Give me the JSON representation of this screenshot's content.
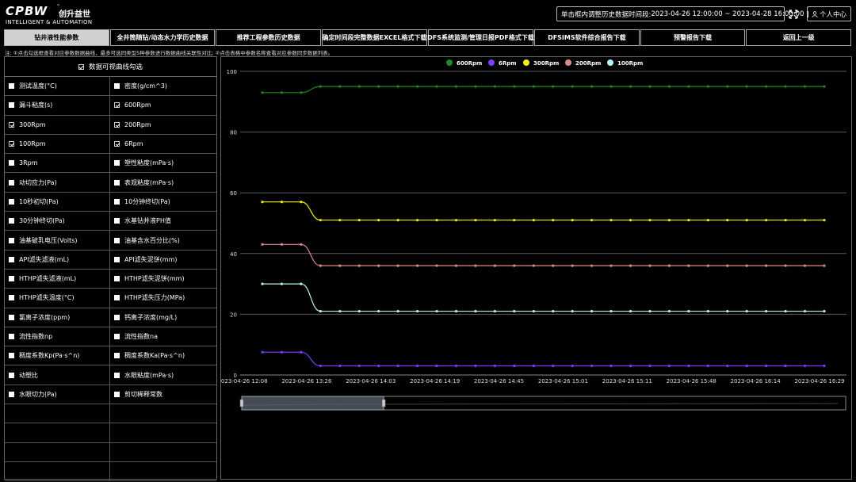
{
  "header": {
    "logo": "CPBW",
    "logo_tm": "™",
    "logo_cn": "创升益世",
    "logo_sub": "INTELLIGENT & AUTOMATION",
    "time_label": "单击框内调整历史数据时间段:",
    "time_range": "2023-04-26 12:00:00 ~ 2023-04-28 16:00:00",
    "user_label": "个人中心"
  },
  "nav": [
    {
      "label": "钻井液性能参数",
      "active": true
    },
    {
      "label": "全井筒随钻/动态水力学历史数据",
      "active": false
    },
    {
      "label": "推荐工程参数历史数据",
      "active": false
    },
    {
      "label": "确定时间段完整数据EXCEL格式下载",
      "active": false
    },
    {
      "label": "DFS系统监测/管理日报PDF格式下载",
      "active": false
    },
    {
      "label": "DFSIMS软件综合报告下载",
      "active": false
    },
    {
      "label": "预警报告下载",
      "active": false
    },
    {
      "label": "返回上一级",
      "active": false
    }
  ],
  "note": "注: ①点击勾选框查看对应参数数据曲线，最多可选同类型5种参数进行数据曲线关联性对比; ②点击表格中参数名称查看对应参数同步数据列表。",
  "params_head": "数据可视曲线勾选",
  "params": [
    {
      "left": "测试温度(°C)",
      "left_on": false,
      "right": "密度(g/cm^3)",
      "right_on": false
    },
    {
      "left": "漏斗粘度(s)",
      "left_on": false,
      "right": "600Rpm",
      "right_on": true
    },
    {
      "left": "300Rpm",
      "left_on": true,
      "right": "200Rpm",
      "right_on": true
    },
    {
      "left": "100Rpm",
      "left_on": true,
      "right": "6Rpm",
      "right_on": true
    },
    {
      "left": "3Rpm",
      "left_on": false,
      "right": "塑性粘度(mPa·s)",
      "right_on": false
    },
    {
      "left": "动切应力(Pa)",
      "left_on": false,
      "right": "表观粘度(mPa·s)",
      "right_on": false
    },
    {
      "left": "10秒初切(Pa)",
      "left_on": false,
      "right": "10分钟终切(Pa)",
      "right_on": false
    },
    {
      "left": "30分钟终切(Pa)",
      "left_on": false,
      "right": "水基钻井液PH值",
      "right_on": false
    },
    {
      "left": "油基破乳电压(Volts)",
      "left_on": false,
      "right": "油基含水百分比(%)",
      "right_on": false
    },
    {
      "left": "API滤失滤液(mL)",
      "left_on": false,
      "right": "API滤失泥饼(mm)",
      "right_on": false
    },
    {
      "left": "HTHP滤失滤液(mL)",
      "left_on": false,
      "right": "HTHP滤失泥饼(mm)",
      "right_on": false
    },
    {
      "left": "HTHP滤失温度(°C)",
      "left_on": false,
      "right": "HTHP滤失压力(MPa)",
      "right_on": false
    },
    {
      "left": "氯离子浓度(ppm)",
      "left_on": false,
      "right": "钙离子浓度(mg/L)",
      "right_on": false
    },
    {
      "left": "流性指数np",
      "left_on": false,
      "right": "流性指数na",
      "right_on": false
    },
    {
      "left": "稠度系数Kp(Pa·s^n)",
      "left_on": false,
      "right": "稠度系数Ka(Pa·s^n)",
      "right_on": false
    },
    {
      "left": "动塑比",
      "left_on": false,
      "right": "水眼粘度(mPa·s)",
      "right_on": false
    },
    {
      "left": "水眼切力(Pa)",
      "left_on": false,
      "right": "剪切稀释常数",
      "right_on": false
    },
    {
      "left": "",
      "left_on": null,
      "right": "",
      "right_on": null
    },
    {
      "left": "",
      "left_on": null,
      "right": "",
      "right_on": null
    },
    {
      "left": "",
      "left_on": null,
      "right": "",
      "right_on": null
    },
    {
      "left": "",
      "left_on": null,
      "right": "",
      "right_on": null
    }
  ],
  "chart_data": {
    "type": "line",
    "ylim": [
      0,
      100
    ],
    "yticks": [
      0,
      20,
      40,
      60,
      80,
      100
    ],
    "xtick_labels": [
      "2023-04-26 12:08",
      "2023-04-26 13:26",
      "2023-04-26 14:03",
      "2023-04-26 14:19",
      "2023-04-26 14:45",
      "2023-04-26 15:01",
      "2023-04-26 15:11",
      "2023-04-26 15:48",
      "2023-04-26 16:14",
      "2023-04-26 16:29"
    ],
    "legend_position": "top-center",
    "grid": true,
    "zoom_window": [
      0.0,
      0.235
    ],
    "series": [
      {
        "name": "600Rpm",
        "color": "#1f8a1f",
        "values": [
          93,
          93,
          93,
          95,
          95,
          95,
          95,
          95,
          95,
          95,
          95,
          95,
          95,
          95,
          95,
          95,
          95,
          95,
          95,
          95,
          95,
          95,
          95,
          95,
          95,
          95,
          95,
          95,
          95,
          95
        ]
      },
      {
        "name": "6Rpm",
        "color": "#7b3dfa",
        "values": [
          7.5,
          7.5,
          7.5,
          3,
          3,
          3,
          3,
          3,
          3,
          3,
          3,
          3,
          3,
          3,
          3,
          3,
          3,
          3,
          3,
          3,
          3,
          3,
          3,
          3,
          3,
          3,
          3,
          3,
          3,
          3
        ]
      },
      {
        "name": "300Rpm",
        "color": "#f0ee16",
        "values": [
          57,
          57,
          57,
          51,
          51,
          51,
          51,
          51,
          51,
          51,
          51,
          51,
          51,
          51,
          51,
          51,
          51,
          51,
          51,
          51,
          51,
          51,
          51,
          51,
          51,
          51,
          51,
          51,
          51,
          51
        ]
      },
      {
        "name": "200Rpm",
        "color": "#e08a8c",
        "values": [
          43,
          43,
          43,
          36,
          36,
          36,
          36,
          36,
          36,
          36,
          36,
          36,
          36,
          36,
          36,
          36,
          36,
          36,
          36,
          36,
          36,
          36,
          36,
          36,
          36,
          36,
          36,
          36,
          36,
          36
        ]
      },
      {
        "name": "100Rpm",
        "color": "#b8f4f4",
        "values": [
          30,
          30,
          30,
          21,
          21,
          21,
          21,
          21,
          21,
          21,
          21,
          21,
          21,
          21,
          21,
          21,
          21,
          21,
          21,
          21,
          21,
          21,
          21,
          21,
          21,
          21,
          21,
          21,
          21,
          21
        ]
      }
    ]
  }
}
